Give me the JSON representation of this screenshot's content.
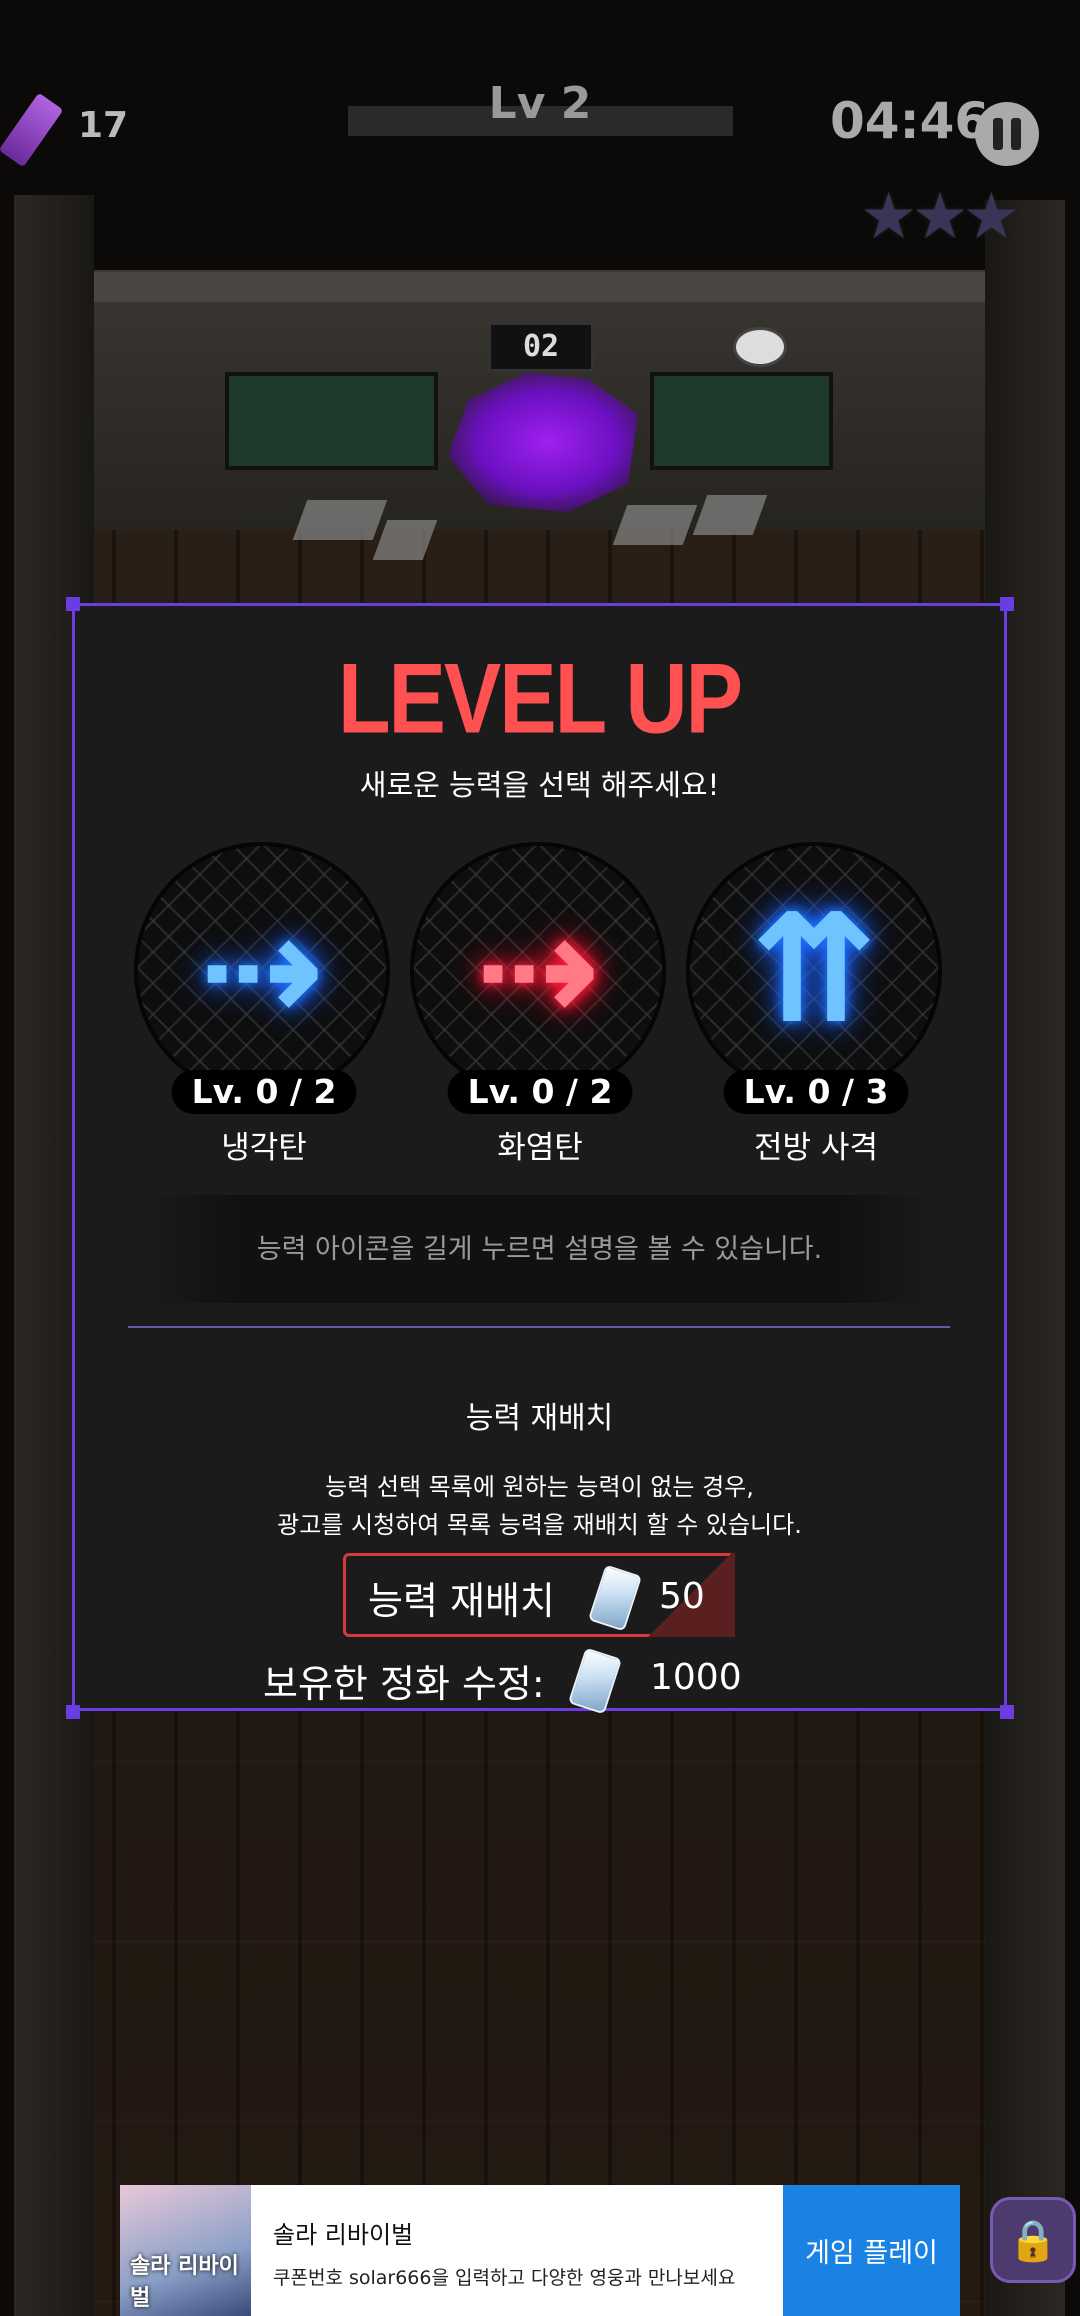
{
  "hud": {
    "item_count": "17",
    "level": "Lv 2",
    "timer": "04:46",
    "stars": "★★★",
    "stars_earned": 0,
    "stars_total": 3
  },
  "scene": {
    "door_sign": "02"
  },
  "panel": {
    "title": "LEVEL UP",
    "subtitle": "새로운 능력을 선택 해주세요!",
    "skills": [
      {
        "level": "Lv. 0 / 2",
        "name": "냉각탄",
        "glyph": "⇢",
        "color": "blue"
      },
      {
        "level": "Lv. 0 / 2",
        "name": "화염탄",
        "glyph": "⇢",
        "color": "red"
      },
      {
        "level": "Lv. 0 / 3",
        "name": "전방 사격",
        "glyph": "⇈",
        "color": "blue"
      }
    ],
    "hint": "능력 아이콘을 길게 누르면 설명을 볼 수 있습니다.",
    "reroll": {
      "title": "능력 재배치",
      "desc_line1": "능력 선택 목록에 원하는 능력이 없는 경우,",
      "desc_line2": "광고를 시청하여 목록 능력을 재배치 할 수 있습니다.",
      "button_label": "능력 재배치",
      "cost": "50"
    },
    "owned": {
      "label": "보유한 정화 수정:",
      "value": "1000"
    }
  },
  "ad": {
    "image_text": "솔라 리바이벌",
    "title": "솔라 리바이벌",
    "desc": "쿠폰번호 solar666을 입력하고 다양한 영웅과 만나보세요",
    "cta": "게임 플레이"
  },
  "colors": {
    "accent_border": "#6a3de0",
    "title_red": "#ff5151",
    "reroll_border": "#d83a3a",
    "ad_cta": "#1a82e2"
  }
}
